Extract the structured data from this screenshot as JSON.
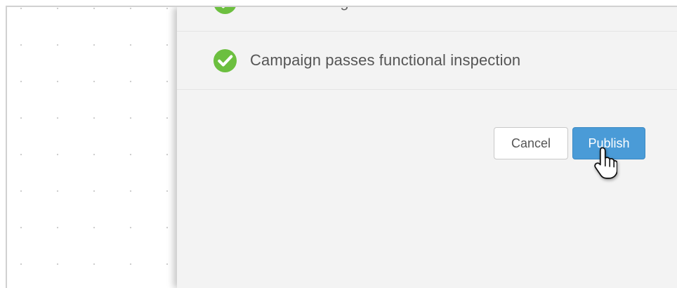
{
  "checks": [
    {
      "label": "All email merge fields are valid",
      "status": "passed",
      "icon": "check-circle-icon"
    },
    {
      "label": "Campaign passes functional inspection",
      "status": "passed",
      "icon": "check-circle-icon"
    }
  ],
  "actions": {
    "cancel_label": "Cancel",
    "publish_label": "Publish"
  },
  "cursor": {
    "icon": "hand-pointer-icon"
  },
  "colors": {
    "success": "#6cbf3f",
    "primary": "#4a9bd7",
    "panel_background": "#f3f3f3",
    "canvas_dot": "#c9c9c9"
  }
}
